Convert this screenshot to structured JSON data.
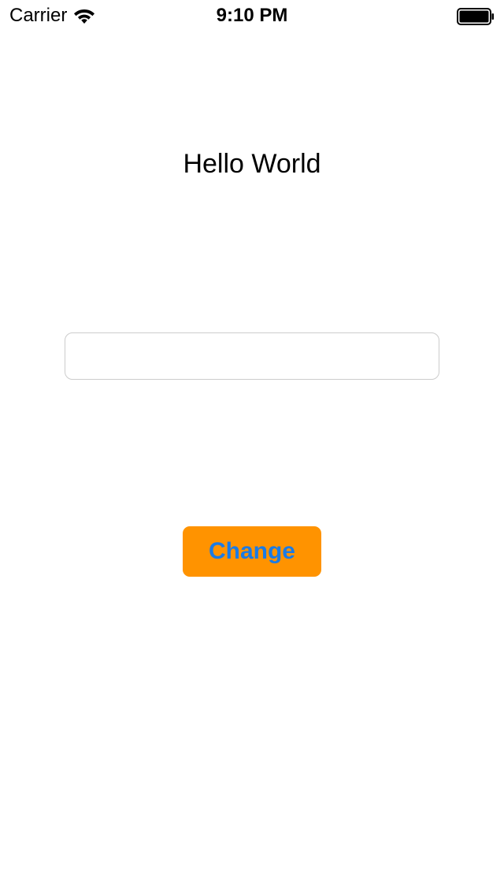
{
  "status_bar": {
    "carrier": "Carrier",
    "time": "9:10 PM",
    "wifi_icon": "wifi-icon",
    "battery_icon": "battery-icon",
    "battery_level": 1.0
  },
  "main": {
    "label_text": "Hello World",
    "text_field": {
      "value": "",
      "placeholder": ""
    },
    "button_label": "Change"
  },
  "colors": {
    "button_background": "#ff9300",
    "button_text": "#1b7be5",
    "field_border": "#cccccc",
    "background": "#ffffff"
  }
}
